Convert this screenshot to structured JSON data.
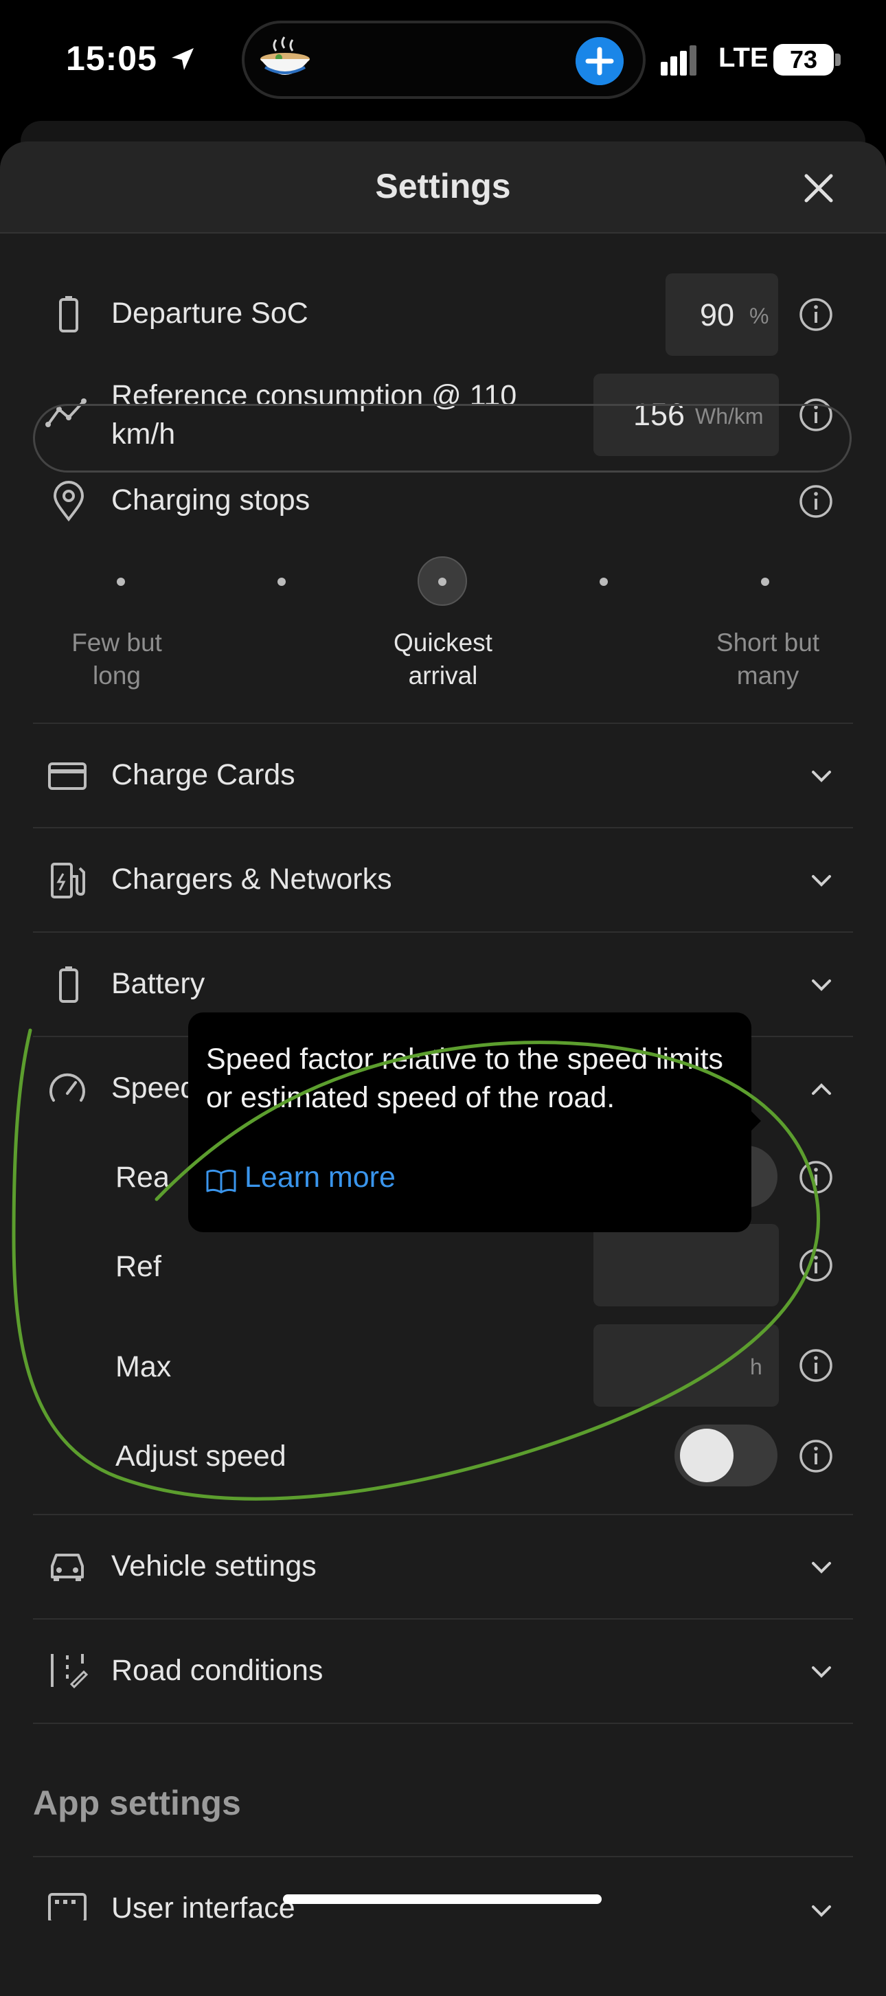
{
  "status_bar": {
    "time": "15:05",
    "network": "LTE",
    "battery": "73"
  },
  "header": {
    "title": "Settings"
  },
  "departure_soc": {
    "label": "Departure SoC",
    "value": "90",
    "unit": "%"
  },
  "reference_consumption": {
    "label_line1": "Reference consumption @ 110",
    "label_line2": "km/h",
    "value": "156",
    "unit": "Wh/km"
  },
  "charging_stops": {
    "label": "Charging stops",
    "options": [
      {
        "line1": "Few but",
        "line2": "long"
      },
      {
        "line1": "Quickest",
        "line2": "arrival"
      },
      {
        "line1": "Short but",
        "line2": "many"
      }
    ],
    "selected_index": 2
  },
  "sections": {
    "charge_cards": "Charge Cards",
    "chargers_networks": "Chargers & Networks",
    "battery": "Battery",
    "speed": "Speed",
    "vehicle_settings": "Vehicle settings",
    "road_conditions": "Road conditions",
    "user_interface": "User interface"
  },
  "speed_section": {
    "row1_label": "Rea",
    "row2_label": "Ref",
    "row3_label": "Max",
    "row3_unit": "h",
    "adjust_speed": "Adjust speed"
  },
  "tooltip": {
    "text": "Speed factor relative to the speed limits or estimated speed of the road.",
    "link": "Learn more"
  },
  "app_settings_heading": "App settings",
  "colors": {
    "accent": "#1a86e8",
    "link": "#3a95ec",
    "annotation": "#5c9e2e"
  }
}
